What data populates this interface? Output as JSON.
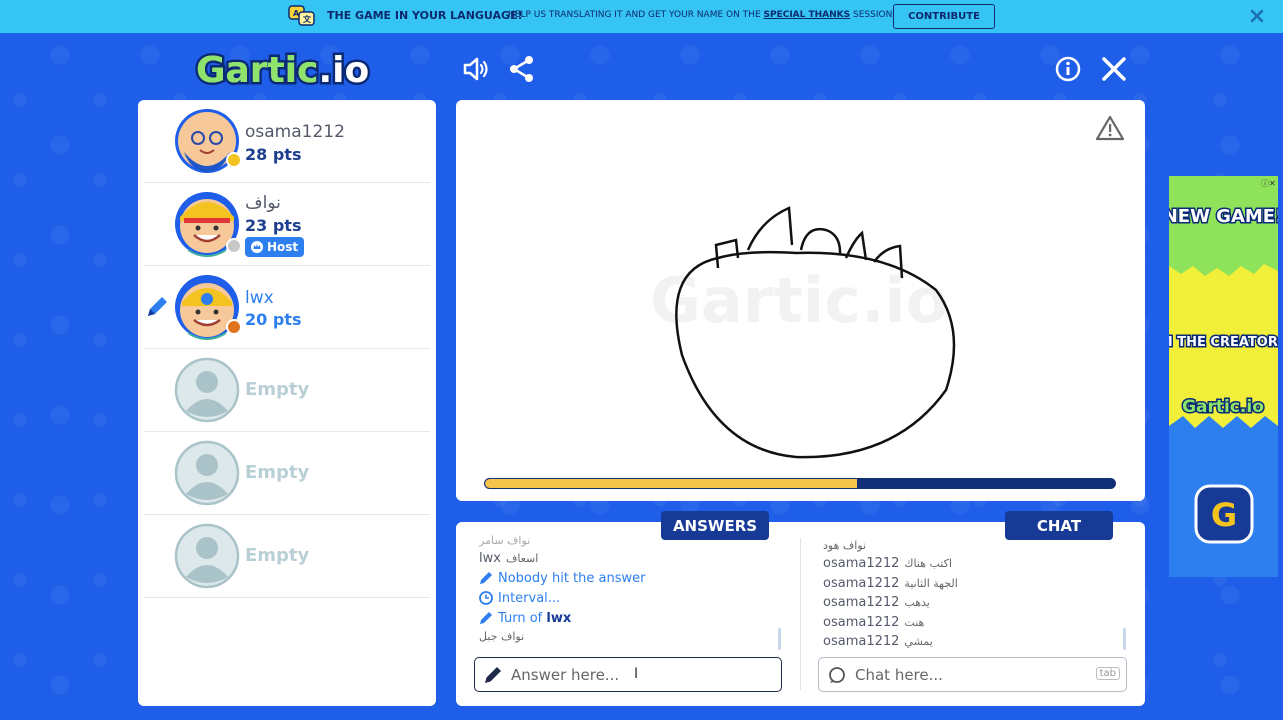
{
  "banner": {
    "title": "THE GAME IN YOUR LANGUAGE!",
    "text_before": "HELP US TRANSLATING IT AND GET YOUR NAME ON THE ",
    "text_link": "SPECIAL THANKS",
    "text_after": " SESSION",
    "button": "CONTRIBUTE",
    "close_icon": "close-icon"
  },
  "header": {
    "logo_text": "Gartic.io",
    "icons": [
      "sound-icon",
      "share-icon",
      "info-icon",
      "close-icon"
    ]
  },
  "players": [
    {
      "name": "osama1212",
      "points": "28 pts",
      "status_color": "#f3c320"
    },
    {
      "name": "نواف",
      "points": "23 pts",
      "status_color": "#c8c8c8",
      "badge": "Host"
    },
    {
      "name": "lwx",
      "points": "20 pts",
      "status_color": "#e0741e",
      "drawing": true
    },
    {
      "name": "Empty"
    },
    {
      "name": "Empty"
    },
    {
      "name": "Empty"
    }
  ],
  "board": {
    "progress": 0.59,
    "report_icon": "warning-icon"
  },
  "answers": {
    "tab": "ANSWERS",
    "lines": [
      {
        "type": "partial",
        "text": "نواف سامر"
      },
      {
        "type": "user",
        "user": "lwx",
        "text": "اسعاف"
      },
      {
        "type": "sys",
        "icon": "pencil-icon",
        "text": "Nobody hit the answer"
      },
      {
        "type": "sys",
        "icon": "clock-icon",
        "text": "Interval..."
      },
      {
        "type": "sys",
        "icon": "pencil-icon",
        "text": "Turn of ",
        "bold": "lwx"
      },
      {
        "type": "partial",
        "text": "نواف جبل"
      }
    ],
    "placeholder": "Answer here..."
  },
  "chat": {
    "tab": "CHAT",
    "lines": [
      {
        "user": "",
        "text": "نواف هود"
      },
      {
        "user": "osama1212",
        "text": "اكتب هناك"
      },
      {
        "user": "osama1212",
        "text": "الجهة الثانية"
      },
      {
        "user": "osama1212",
        "text": "يدهب"
      },
      {
        "user": "osama1212",
        "text": "هنت"
      },
      {
        "user": "osama1212",
        "text": "يمشي"
      }
    ],
    "placeholder": "Chat here...",
    "key_hint": "tab"
  },
  "ad": {
    "line1": "NEW GAME!",
    "line2": "FROM THE CREATORS OF:",
    "brand": "Gartic.io",
    "close_glyph": "ⓘ✕"
  },
  "colors": {
    "background": "#1f5ee8",
    "banner": "#35c4f3",
    "navy": "#163a96",
    "accent_blue": "#2d7ff0",
    "progress_fill": "#f5c44a"
  }
}
